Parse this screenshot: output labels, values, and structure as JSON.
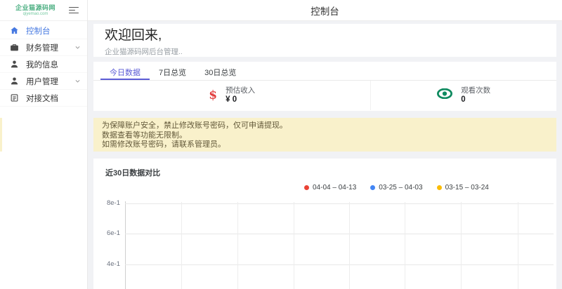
{
  "sidebar": {
    "logo": {
      "text": "企业猫源码网",
      "domain": "qiyemao.com",
      "color": "#4caf82"
    },
    "items": [
      {
        "label": "控制台",
        "icon": "home",
        "active": true,
        "expandable": false
      },
      {
        "label": "财务管理",
        "icon": "briefcase",
        "active": false,
        "expandable": true
      },
      {
        "label": "我的信息",
        "icon": "user",
        "active": false,
        "expandable": false
      },
      {
        "label": "用户管理",
        "icon": "users",
        "active": false,
        "expandable": true
      },
      {
        "label": "对接文档",
        "icon": "document",
        "active": false,
        "expandable": false
      }
    ],
    "active_color": "#4679e1"
  },
  "header": {
    "title": "控制台"
  },
  "welcome": {
    "heading": "欢迎回来,",
    "subtitle": "企业猫源码网后台管理.."
  },
  "tabs": [
    {
      "label": "今日数据",
      "active": true
    },
    {
      "label": "7日总览",
      "active": false
    },
    {
      "label": "30日总览",
      "active": false
    }
  ],
  "tabs_accent_color": "#5b5bd6",
  "stats": [
    {
      "icon": "dollar-icon",
      "icon_glyph": "$",
      "icon_color": "#e23d3d",
      "label": "预估收入",
      "value": "¥ 0"
    },
    {
      "icon": "eye-icon",
      "icon_color": "#0e8a5f",
      "label": "观看次数",
      "value": "0"
    }
  ],
  "notice": {
    "bg_color": "#f9f1cb",
    "lines": [
      "为保障账户安全，禁止修改账号密码，仅可申请提现。",
      "数据查看等功能无限制。",
      "如需修改账号密码，请联系管理员。"
    ]
  },
  "chart_data": {
    "type": "line",
    "title": "近30日数据对比",
    "series": [
      {
        "name": "04-04 – 04-13",
        "color": "#ea4335",
        "values": []
      },
      {
        "name": "03-25 – 04-03",
        "color": "#4285f4",
        "values": []
      },
      {
        "name": "03-15 – 03-24",
        "color": "#fbbc05",
        "values": []
      }
    ],
    "x": [],
    "y_ticks_visible": [
      "8e-1",
      "6e-1",
      "4e-1"
    ],
    "grid": true,
    "legend_position": "top"
  }
}
